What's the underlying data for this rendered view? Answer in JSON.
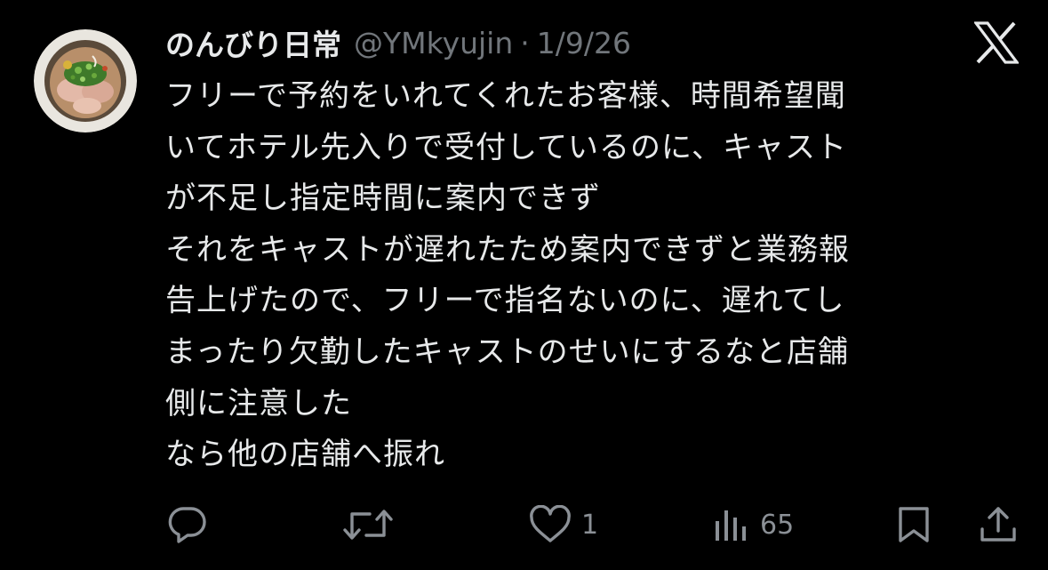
{
  "tweet": {
    "author": {
      "display_name": "のんびり日常",
      "handle": "@YMkyujin",
      "separator": "·",
      "date": "1/9/26"
    },
    "body_lines": [
      "フリーで予約をいれてくれたお客様、時間希望聞",
      "いてホテル先入りで受付しているのに、キャスト",
      "が不足し指定時間に案内できず",
      "それをキャストが遅れたため案内できずと業務報",
      "告上げたので、フリーで指名ないのに、遅れてし",
      "まったり欠勤したキャストのせいにするなと店舗",
      "側に注意した",
      "なら他の店舗へ振れ"
    ],
    "actions": {
      "reply_count": "",
      "retweet_count": "",
      "like_count": "1",
      "views_count": "65"
    }
  },
  "icons": {
    "avatar": "avatar-food-bowl",
    "brand": "x-logo",
    "reply": "reply-icon",
    "retweet": "retweet-icon",
    "like": "heart-icon",
    "views": "views-icon",
    "bookmark": "bookmark-icon",
    "share": "share-icon"
  },
  "colors": {
    "background": "#000000",
    "text_primary": "#e7e9ea",
    "text_secondary": "#71767b"
  }
}
